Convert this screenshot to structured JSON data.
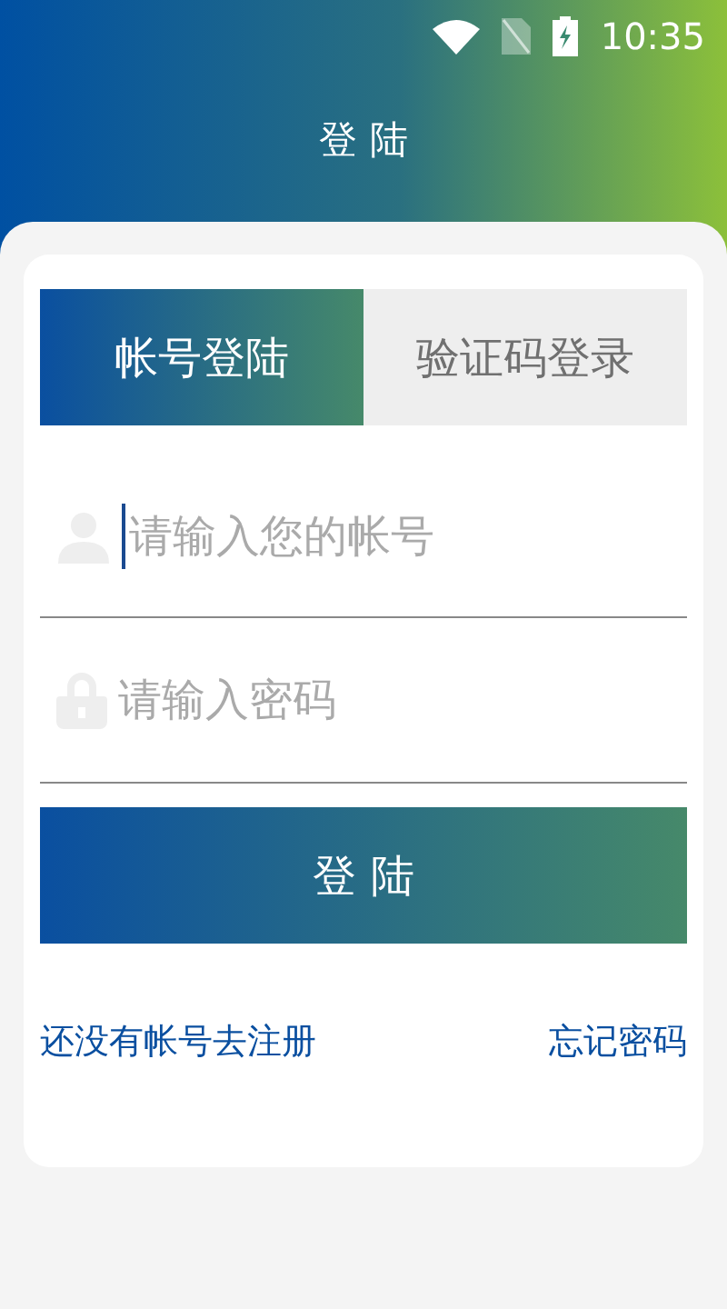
{
  "status_bar": {
    "time": "10:35"
  },
  "header": {
    "title": "登 陆"
  },
  "tabs": [
    {
      "label": "帐号登陆",
      "selected": true
    },
    {
      "label": "验证码登录",
      "selected": false
    }
  ],
  "fields": [
    {
      "kind": "account",
      "placeholder": "请输入您的帐号",
      "focused": true
    },
    {
      "kind": "password",
      "placeholder": "请输入密码",
      "focused": false
    }
  ],
  "login_button": "登 陆",
  "links": {
    "register": "还没有帐号去注册",
    "forgot": "忘记密码"
  }
}
